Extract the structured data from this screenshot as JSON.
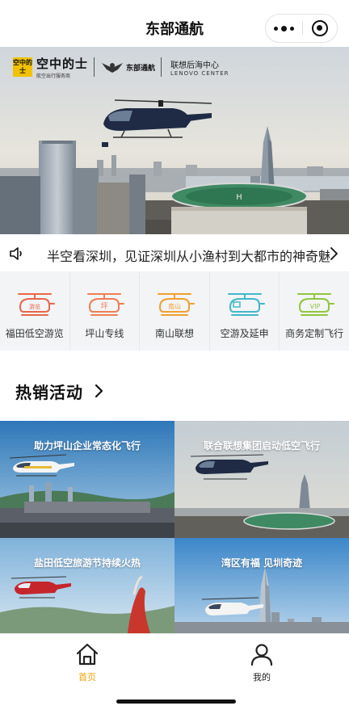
{
  "app": {
    "title": "东部通航"
  },
  "colors": {
    "accent": "#f0a30a",
    "tab_inactive": "#222222"
  },
  "hero": {
    "brand_box": "空中的士",
    "brand_name": "空中的士",
    "brand_sub": "航空出行服务商",
    "brand_east": "东部通航",
    "brand_lenovo_cn": "联想后海中心",
    "brand_lenovo_en": "LENOVO CENTER"
  },
  "notice": {
    "icon": "speaker-icon",
    "text": "半空看深圳，见证深圳从小渔村到大都市的神奇魅力"
  },
  "services": [
    {
      "label": "福田低空游览",
      "badge": "游览",
      "color": "#e8664a"
    },
    {
      "label": "坪山专线",
      "badge": "坪",
      "color": "#ee7e55"
    },
    {
      "label": "南山联想",
      "badge": "南山",
      "color": "#f0a030"
    },
    {
      "label": "空游及延申",
      "badge": "",
      "color": "#42b7c8"
    },
    {
      "label": "商务定制飞行",
      "badge": "VIP",
      "color": "#8ec63f"
    }
  ],
  "section": {
    "title": "热销活动"
  },
  "activities": [
    {
      "title": "助力坪山企业常态化飞行"
    },
    {
      "title": "联合联想集团启动低空飞行"
    },
    {
      "title": "盐田低空旅游节持续火热"
    },
    {
      "title": "湾区有福   见圳奇迹"
    }
  ],
  "tabbar": {
    "tabs": [
      {
        "label": "首页",
        "icon": "home-icon",
        "active": true
      },
      {
        "label": "我的",
        "icon": "user-icon",
        "active": false
      }
    ]
  }
}
